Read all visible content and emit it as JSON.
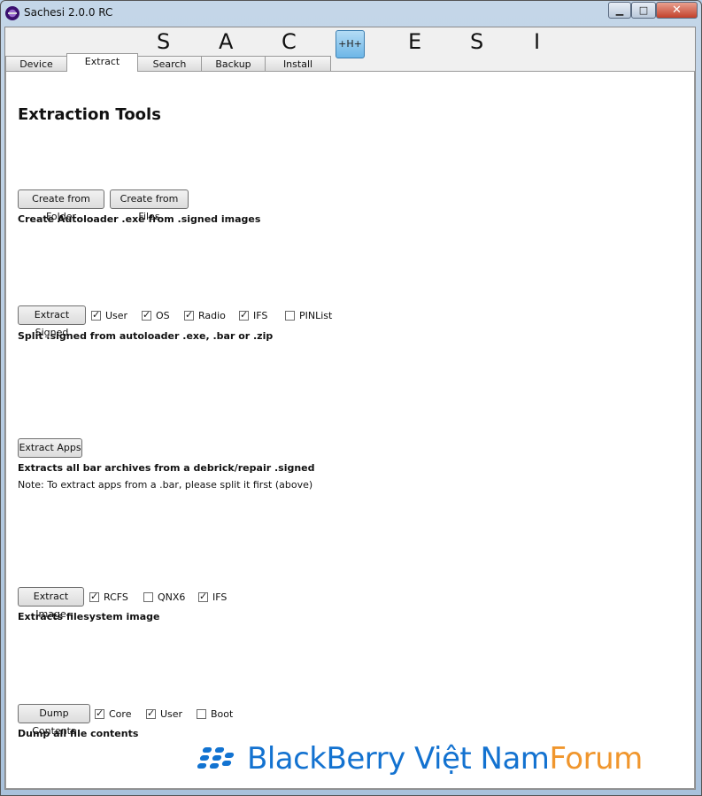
{
  "window": {
    "title": "Sachesi 2.0.0 RC",
    "controls": {
      "minimize": "▁",
      "maximize": "□",
      "close": "✕"
    }
  },
  "header": {
    "letters": [
      "S",
      "A",
      "C",
      "E",
      "S",
      "I"
    ],
    "h_button": "+H+"
  },
  "tabs": [
    {
      "label": "Device",
      "active": false
    },
    {
      "label": "Extract",
      "active": true
    },
    {
      "label": "Search",
      "active": false
    },
    {
      "label": "Backup",
      "active": false
    },
    {
      "label": "Install",
      "active": false
    }
  ],
  "page": {
    "heading": "Extraction Tools",
    "autoloader": {
      "btn_folder": "Create from Folder",
      "btn_files": "Create from Files",
      "desc": "Create Autoloader .exe from .signed images"
    },
    "signed": {
      "button": "Extract Signed",
      "options": [
        {
          "label": "User",
          "checked": true
        },
        {
          "label": "OS",
          "checked": true
        },
        {
          "label": "Radio",
          "checked": true
        },
        {
          "label": "IFS",
          "checked": true
        },
        {
          "label": "PINList",
          "checked": false
        }
      ],
      "desc": "Split .signed from autoloader .exe, .bar or .zip"
    },
    "apps": {
      "button": "Extract Apps",
      "desc": "Extracts all bar archives from a debrick/repair .signed",
      "note": "Note: To extract apps from a .bar, please split it first (above)"
    },
    "image": {
      "button": "Extract Image",
      "options": [
        {
          "label": "RCFS",
          "checked": true
        },
        {
          "label": "QNX6",
          "checked": false
        },
        {
          "label": "IFS",
          "checked": true
        }
      ],
      "desc": "Extracts filesystem image"
    },
    "dump": {
      "button": "Dump Contents",
      "options": [
        {
          "label": "Core",
          "checked": true
        },
        {
          "label": "User",
          "checked": true
        },
        {
          "label": "Boot",
          "checked": false
        }
      ],
      "desc": "Dump all file contents"
    }
  },
  "watermark": {
    "part1": "BlackBerry Việt Nam ",
    "part2": "Forum",
    "colors": {
      "blue": "#1372d0",
      "orange": "#f0962d"
    }
  }
}
